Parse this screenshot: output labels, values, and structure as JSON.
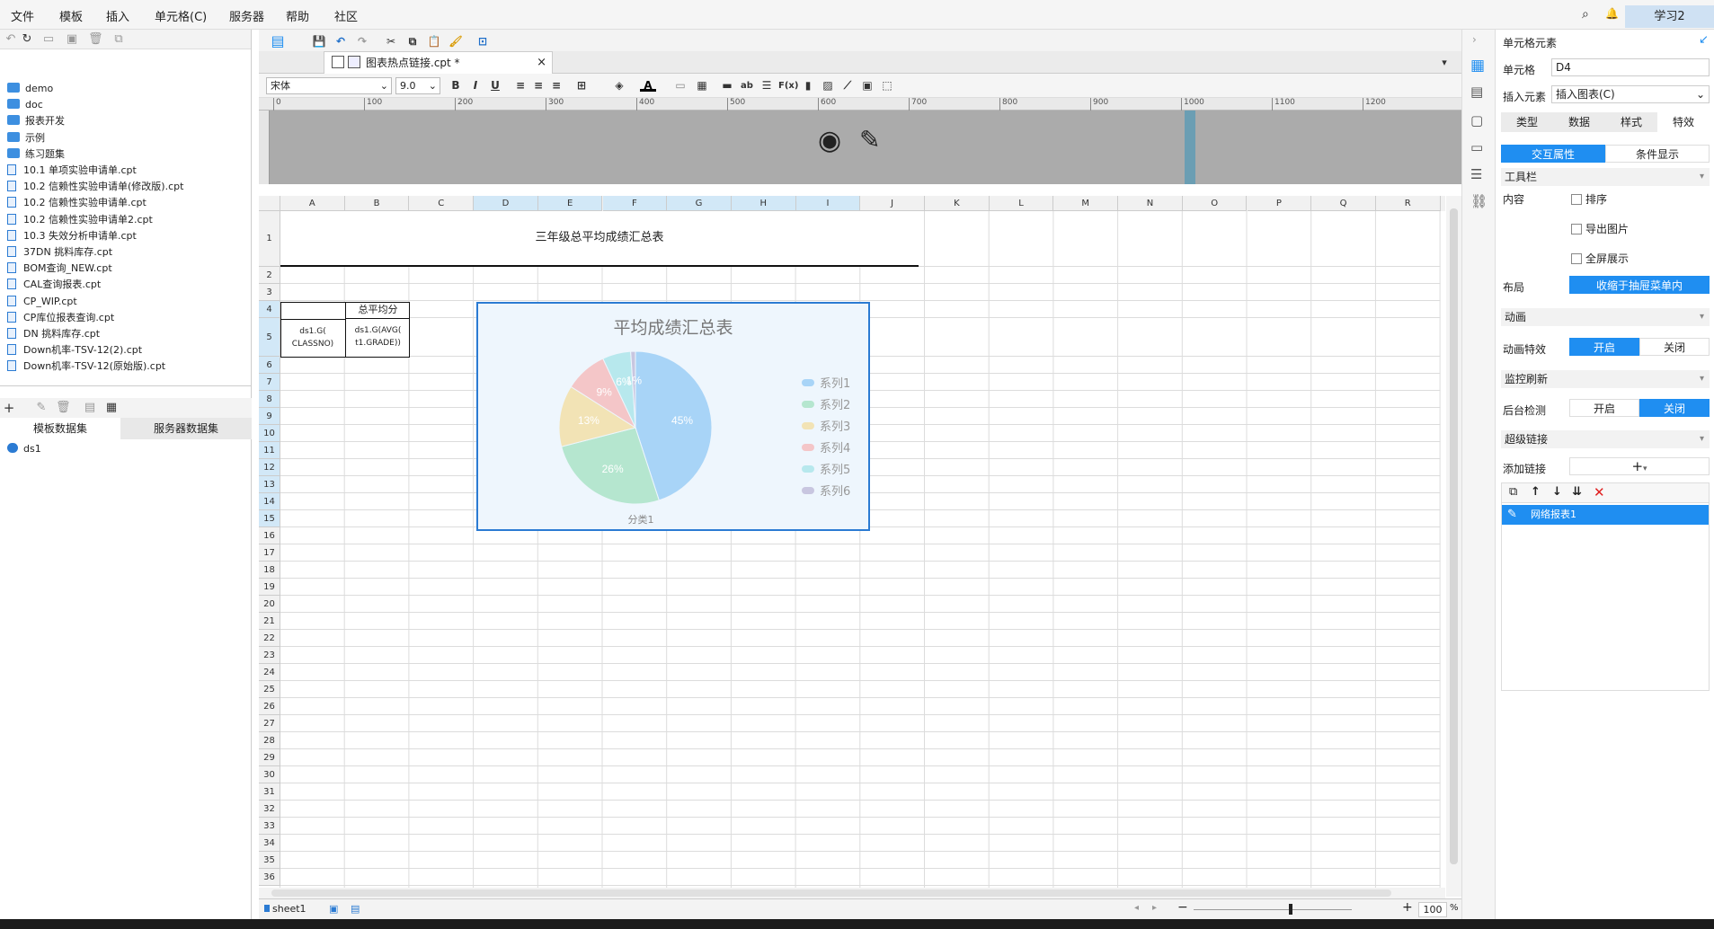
{
  "menu": [
    "文件",
    "模板",
    "插入",
    "单元格(C)",
    "服务器",
    "帮助",
    "社区"
  ],
  "user_label": "学习2",
  "tree": [
    {
      "type": "folder",
      "label": "demo"
    },
    {
      "type": "folder",
      "label": "doc"
    },
    {
      "type": "folder",
      "label": "报表开发"
    },
    {
      "type": "folder",
      "label": "示例"
    },
    {
      "type": "folder",
      "label": "练习题集"
    },
    {
      "type": "file",
      "label": "10.1 单项实验申请单.cpt"
    },
    {
      "type": "file",
      "label": "10.2 信赖性实验申请单(修改版).cpt"
    },
    {
      "type": "file",
      "label": "10.2 信赖性实验申请单.cpt"
    },
    {
      "type": "file",
      "label": "10.2 信赖性实验申请单2.cpt"
    },
    {
      "type": "file",
      "label": "10.3 失效分析申请单.cpt"
    },
    {
      "type": "file",
      "label": "37DN 挑料库存.cpt"
    },
    {
      "type": "file",
      "label": "BOM查询_NEW.cpt"
    },
    {
      "type": "file",
      "label": "CAL查询报表.cpt"
    },
    {
      "type": "file",
      "label": "CP_WIP.cpt"
    },
    {
      "type": "file",
      "label": "CP库位报表查询.cpt"
    },
    {
      "type": "file",
      "label": "DN 挑料库存.cpt"
    },
    {
      "type": "file",
      "label": "Down机率-TSV-12(2).cpt"
    },
    {
      "type": "file",
      "label": "Down机率-TSV-12(原始版).cpt"
    }
  ],
  "dataset_tabs": [
    "模板数据集",
    "服务器数据集"
  ],
  "datasets": [
    "ds1"
  ],
  "file_tab": "图表热点链接.cpt *",
  "font_name": "宋体",
  "font_size": "9.0",
  "ruler_ticks": [
    "0",
    "100",
    "200",
    "300",
    "400",
    "500",
    "600",
    "700",
    "800",
    "900",
    "1000",
    "1100",
    "1200"
  ],
  "columns": [
    "A",
    "B",
    "C",
    "D",
    "E",
    "F",
    "G",
    "H",
    "I",
    "J",
    "K",
    "L",
    "M",
    "N",
    "O",
    "P",
    "Q",
    "R"
  ],
  "cells": {
    "title": "三年级总平均成绩汇总表",
    "b4": "总平均分",
    "a5": "ds1.G(\nCLASSNO)",
    "b5": "ds1.G(AVG(\nt1.GRADE))"
  },
  "chart_data": {
    "type": "pie",
    "title": "平均成绩汇总表",
    "categories": [
      "分类1"
    ],
    "series": [
      {
        "name": "系列1",
        "value": 45,
        "label": "45%",
        "color": "#a8d4f7"
      },
      {
        "name": "系列2",
        "value": 26,
        "label": "26%",
        "color": "#b5e6cf"
      },
      {
        "name": "系列3",
        "value": 13,
        "label": "13%",
        "color": "#f2e3b5"
      },
      {
        "name": "系列4",
        "value": 9,
        "label": "9%",
        "color": "#f4c6c8"
      },
      {
        "name": "系列5",
        "value": 6,
        "label": "6%",
        "color": "#b7e8ed"
      },
      {
        "name": "系列6",
        "value": 1,
        "label": "1%",
        "color": "#c8c6e0"
      }
    ],
    "legend_position": "right"
  },
  "sheet_tab": "sheet1",
  "zoom": "100",
  "panel": {
    "header": "单元格元素",
    "cell_label": "单元格",
    "cell_value": "D4",
    "insert_label": "插入元素",
    "insert_value": "插入图表(C)",
    "tabs": [
      "类型",
      "数据",
      "样式",
      "特效"
    ],
    "subtabs": [
      "交互属性",
      "条件显示"
    ],
    "toolbar_section": "工具栏",
    "content_label": "内容",
    "checks": [
      "排序",
      "导出图片",
      "全屏展示"
    ],
    "layout_label": "布局",
    "layout_value": "收缩于抽屉菜单内",
    "anim_section": "动画",
    "anim_label": "动画特效",
    "monitor_section": "监控刷新",
    "monitor_label": "后台检测",
    "on": "开启",
    "off": "关闭",
    "link_section": "超级链接",
    "add_link_label": "添加链接",
    "link_item": "网络报表1"
  }
}
